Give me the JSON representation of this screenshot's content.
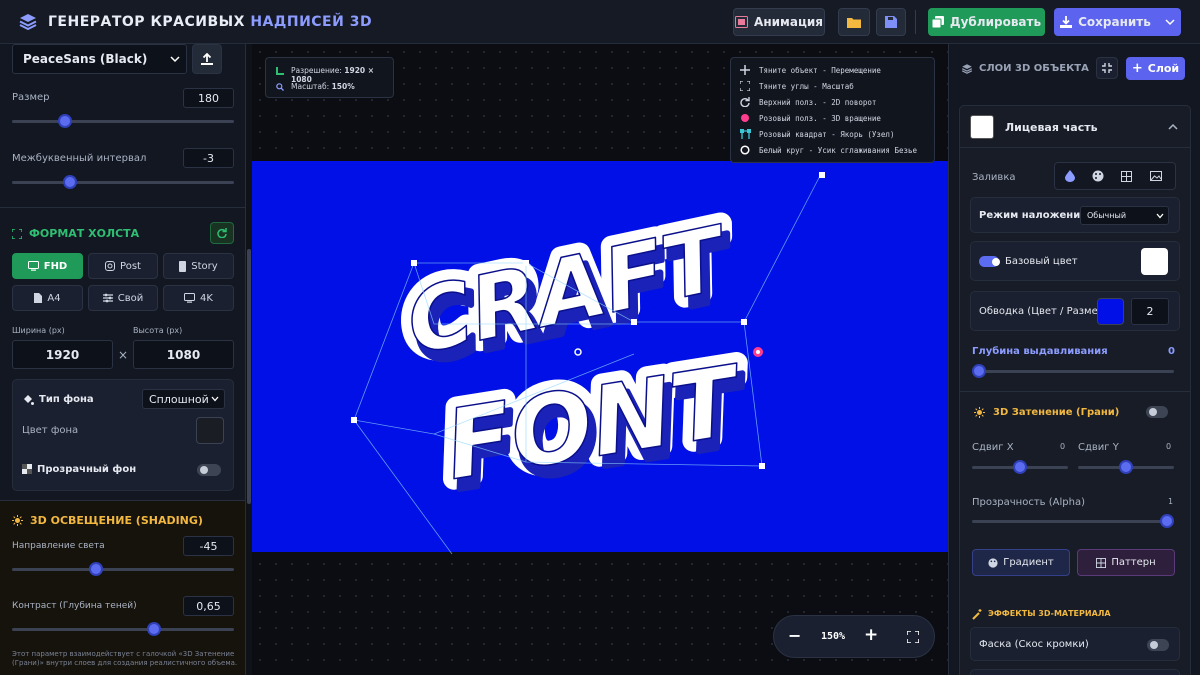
{
  "header": {
    "title_main": "ГЕНЕРАТОР КРАСИВЫХ",
    "title_accent": "НАДПИСЕЙ 3D",
    "animation_label": "Анимация",
    "duplicate_label": "Дублировать",
    "save_label": "Сохранить"
  },
  "left": {
    "font_select": "PeaceSans (Black)",
    "size_label": "Размер",
    "size_value": "180",
    "size_level": 0.24,
    "spacing_label": "Межбуквенный интервал",
    "spacing_value": "-3",
    "spacing_level": 0.26,
    "canvas_format_title": "ФОРМАТ ХОЛСТА",
    "formats": [
      "FHD",
      "Post",
      "Story",
      "A4",
      "Свой",
      "4K"
    ],
    "width_label": "Ширина (px)",
    "height_label": "Высота (px)",
    "width_value": "1920",
    "height_value": "1080",
    "times": "×",
    "bg_type_label": "Тип фона",
    "bg_type_value": "Сплошной",
    "bg_color_label": "Цвет фона",
    "transparent_label": "Прозрачный фон",
    "lighting_title": "3D ОСВЕЩЕНИЕ (SHADING)",
    "light_dir_label": "Направление света",
    "light_dir_value": "-45",
    "light_dir_level": 0.38,
    "contrast_label": "Контраст (Глубина теней)",
    "contrast_value": "0,65",
    "contrast_level": 0.64,
    "hint_1": "Этот параметр взаимодействует с галочкой «3D Затенение",
    "hint_2": "(Грани)» внутри слоев для создания реалистичного объема."
  },
  "canvas": {
    "res_label": "Разрешение:",
    "res_value": "1920 × 1080",
    "scale_label": "Масштаб:",
    "scale_value": "150%",
    "tips": [
      "Тяните объект - Перемещение",
      "Тяните углы - Масштаб",
      "Верхний полз. - 2D поворот",
      "Розовый полз. - 3D вращение",
      "Розовый квадрат - Якорь (Узел)",
      "Белый круг - Усик сглаживания Безье"
    ],
    "word_1": "CRAFT",
    "word_2": "FONT",
    "zoom_value": "150%",
    "zoom_minus": "−",
    "zoom_plus": "+",
    "bg_color": "#0010e6"
  },
  "right": {
    "layers_title": "СЛОИ 3D ОБЪЕКТА",
    "add_layer_label": "Слой",
    "face_label": "Лицевая часть",
    "fill_label": "Заливка",
    "blend_label": "Режим наложения",
    "blend_value": "Обычный",
    "base_color_label": "Базовый цвет",
    "stroke_label": "Обводка (Цвет / Размер)",
    "stroke_value": "2",
    "depth_label": "Глубина выдавливания",
    "depth_value": "0",
    "depth_level": 0,
    "shading_label": "3D Затенение (Грани)",
    "shift_x_label": "Сдвиг X",
    "shift_x_value": "0",
    "shift_y_label": "Сдвиг Y",
    "shift_y_value": "0",
    "shift_level": 0.5,
    "alpha_label": "Прозрачность (Alpha)",
    "alpha_value": "1",
    "alpha_level": 1,
    "gradient_label": "Градиент",
    "pattern_label": "Паттерн",
    "effects_title": "ЭФФЕКТЫ 3D-МАТЕРИАЛА",
    "bevel_label": "Фаска (Скос кромки)"
  }
}
